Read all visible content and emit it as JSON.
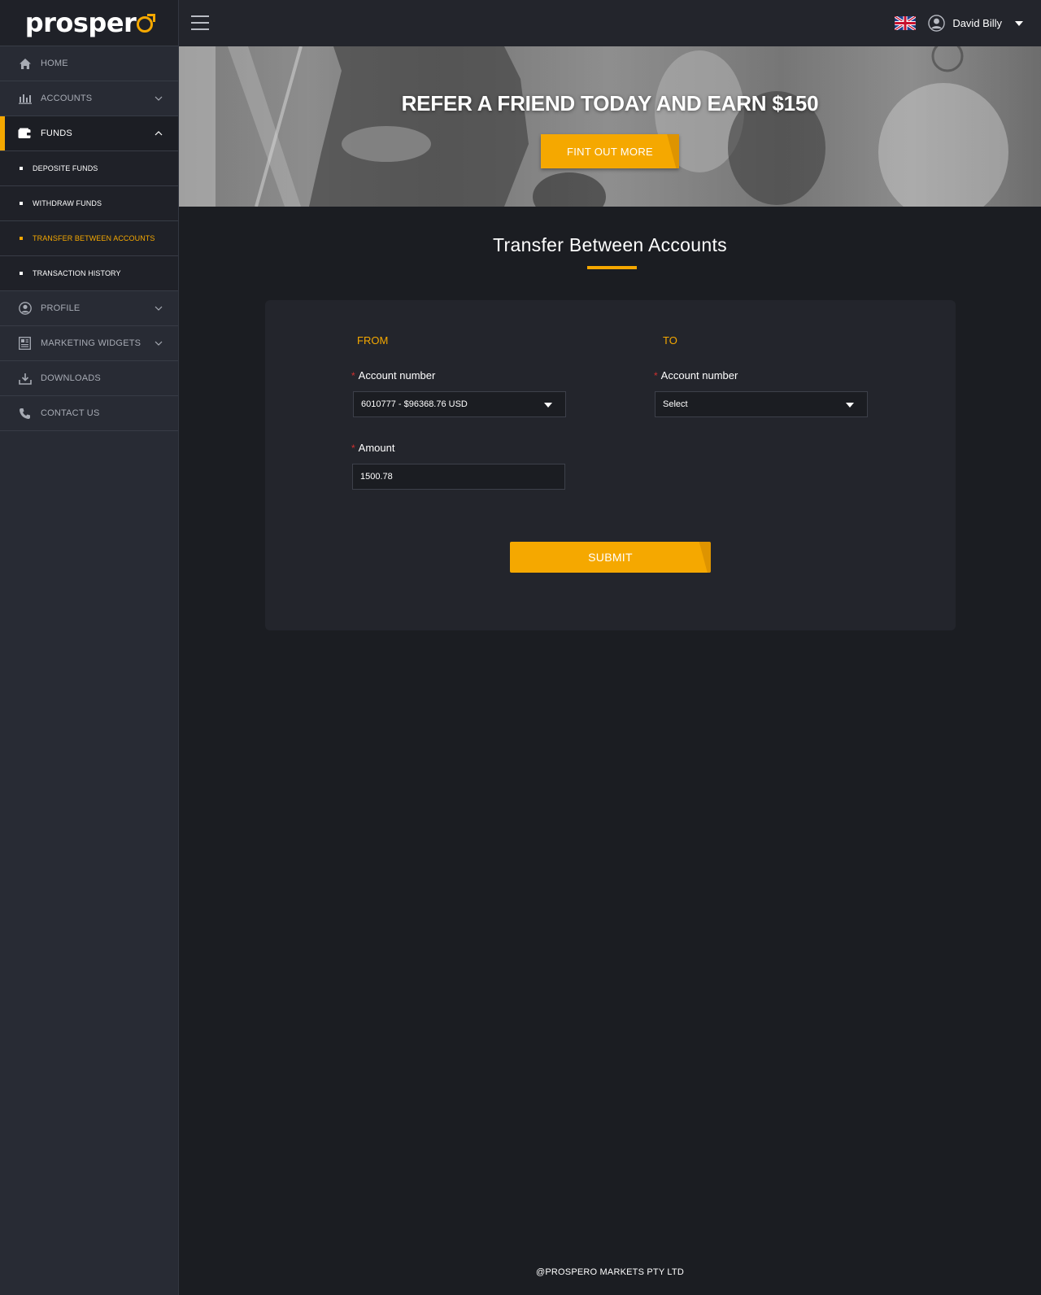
{
  "brand": {
    "logo_text": "prosper"
  },
  "sidebar": {
    "items": [
      {
        "label": "HOME"
      },
      {
        "label": "ACCOUNTS"
      },
      {
        "label": "FUNDS"
      },
      {
        "label": "PROFILE"
      },
      {
        "label": "MARKETING WIDGETS"
      },
      {
        "label": "DOWNLOADS"
      },
      {
        "label": "CONTACT US"
      }
    ],
    "funds_sub": [
      {
        "label": "DEPOSITE FUNDS"
      },
      {
        "label": "WITHDRAW FUNDS"
      },
      {
        "label": "TRANSFER BETWEEN ACCOUNTS"
      },
      {
        "label": "TRANSACTION HISTORY"
      }
    ]
  },
  "topbar": {
    "user_name": "David Billy"
  },
  "banner": {
    "title": "REFER A FRIEND TODAY AND EARN $150",
    "button": "FINT OUT MORE"
  },
  "page": {
    "title": "Transfer Between Accounts"
  },
  "form": {
    "from_label": "FROM",
    "to_label": "TO",
    "required_mark": "*",
    "from_account_label": "Account number",
    "from_account_value": "6010777 - $96368.76 USD",
    "to_account_label": "Account number",
    "to_account_value": "Select",
    "amount_label": "Amount",
    "amount_value": "1500.78",
    "submit": "SUBMIT"
  },
  "footer": {
    "text": "@PROSPERO MARKETS PTY LTD"
  },
  "colors": {
    "accent": "#f5a800",
    "background": "#1b1d22",
    "sidebar": "#282b34",
    "required": "#d0302f"
  }
}
